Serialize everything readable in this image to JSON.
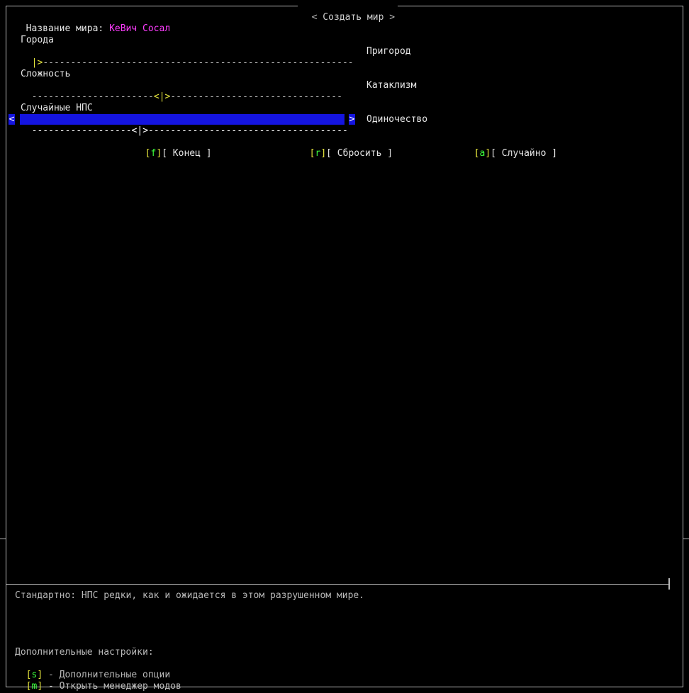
{
  "window": {
    "title": " Создать мир ",
    "world_name_label": "Название мира: ",
    "world_name_value": "КеВич Сосал"
  },
  "sliders": [
    {
      "label": "Города",
      "track_left": "",
      "marker": "|>",
      "track_right": "--------------------------------------------------------",
      "value_label": "Пригород"
    },
    {
      "label": "Сложность",
      "track_left": "----------------------",
      "marker": "<|>",
      "track_right": "-------------------------------",
      "value_label": "Катаклизм"
    },
    {
      "label": "Случайные НПС",
      "track_left": "------------------",
      "marker": "<|>",
      "track_right": "------------------------------------",
      "value_label": "Одиночество",
      "arrow_left": "<",
      "arrow_right": ">"
    }
  ],
  "buttons": {
    "finish": {
      "key_open": "[",
      "key": "f",
      "key_close": "]",
      "label": "[ Конец ]"
    },
    "reset": {
      "key_open": "[",
      "key": "r",
      "key_close": "]",
      "label": "[ Сбросить ]"
    },
    "random": {
      "key_open": "[",
      "key": "a",
      "key_close": "]",
      "label": "[ Случайно ]"
    }
  },
  "description": "Стандартно: НПС редки, как и ожидается в этом разрушенном мире.",
  "footer": {
    "heading": "Дополнительные настройки:",
    "items": [
      {
        "key_open": "[",
        "key": "s",
        "key_close": "]",
        "text": " - Дополнительные опции"
      },
      {
        "key_open": "[",
        "key": "m",
        "key_close": "]",
        "text": " - Открыть менеджер модов"
      }
    ]
  },
  "colors": {
    "background": "#000000",
    "highlight": "#1414e0",
    "accent_name": "#ff3cff",
    "key_green": "#3cff3c",
    "bracket_yellow": "#e6e63c",
    "text": "#cfcfcf"
  }
}
